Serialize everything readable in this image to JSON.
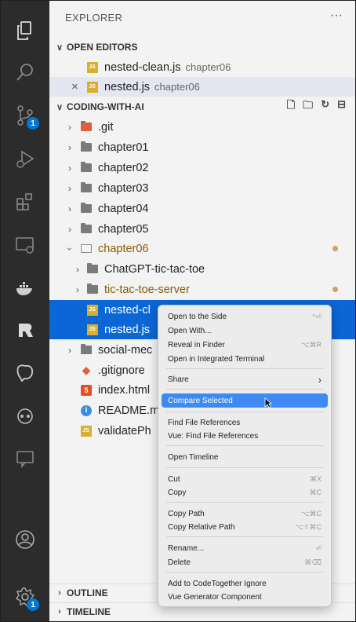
{
  "activity_bar": {
    "scm_badge": "1",
    "settings_badge": "1"
  },
  "explorer": {
    "title": "EXPLORER",
    "more": "···"
  },
  "open_editors": {
    "header": "OPEN EDITORS",
    "items": [
      {
        "name": "nested-clean.js",
        "desc": "chapter06"
      },
      {
        "name": "nested.js",
        "desc": "chapter06",
        "close": "×"
      }
    ]
  },
  "workspace": {
    "header": "CODING-WITH-AI",
    "items": [
      {
        "name": ".git"
      },
      {
        "name": "chapter01"
      },
      {
        "name": "chapter02"
      },
      {
        "name": "chapter03"
      },
      {
        "name": "chapter04"
      },
      {
        "name": "chapter05"
      },
      {
        "name": "chapter06"
      },
      {
        "name": "ChatGPT-tic-tac-toe"
      },
      {
        "name": "tic-tac-toe-server"
      },
      {
        "name": "nested-cl"
      },
      {
        "name": "nested.js"
      },
      {
        "name": "social-mec"
      },
      {
        "name": ".gitignore"
      },
      {
        "name": "index.html"
      },
      {
        "name": "README.m"
      },
      {
        "name": "validatePh"
      }
    ]
  },
  "bottom_sections": {
    "outline": "OUTLINE",
    "timeline": "TIMELINE"
  },
  "context_menu": {
    "items": [
      {
        "label": "Open to the Side",
        "key": "^⏎"
      },
      {
        "label": "Open With...",
        "key": ""
      },
      {
        "label": "Reveal in Finder",
        "key": "⌥⌘R"
      },
      {
        "label": "Open in Integrated Terminal",
        "key": ""
      },
      {
        "label": "Share",
        "key": "›"
      },
      {
        "label": "Compare Selected",
        "key": ""
      },
      {
        "label": "Find File References",
        "key": ""
      },
      {
        "label": "Vue: Find File References",
        "key": ""
      },
      {
        "label": "Open Timeline",
        "key": ""
      },
      {
        "label": "Cut",
        "key": "⌘X"
      },
      {
        "label": "Copy",
        "key": "⌘C"
      },
      {
        "label": "Copy Path",
        "key": "⌥⌘C"
      },
      {
        "label": "Copy Relative Path",
        "key": "⌥⇧⌘C"
      },
      {
        "label": "Rename...",
        "key": "⏎"
      },
      {
        "label": "Delete",
        "key": "⌘⌫"
      },
      {
        "label": "Add to CodeTogether Ignore",
        "key": ""
      },
      {
        "label": "Vue Generator Component",
        "key": ""
      }
    ]
  }
}
